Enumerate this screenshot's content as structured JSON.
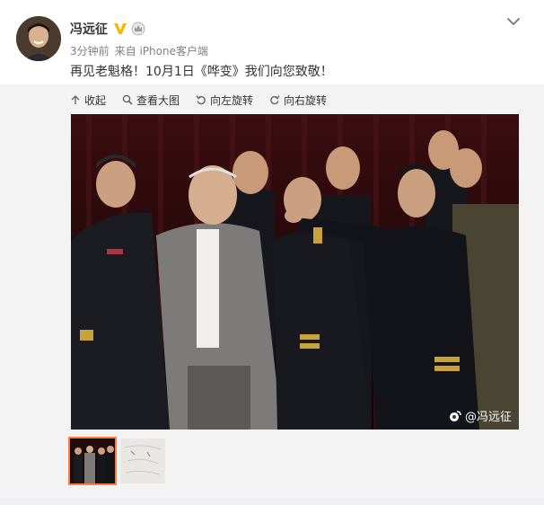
{
  "post": {
    "username": "冯远征",
    "time_ago": "3分钟前",
    "source": "来自 iPhone客户端",
    "text": "再见老魁格！10月1日《哗变》我们向您致敬！",
    "icons": {
      "verified": "verified-v-icon",
      "crown": "crown-badge-icon",
      "more": "chevron-down-icon"
    }
  },
  "toolbar": {
    "collapse": "收起",
    "view_large": "查看大图",
    "rotate_left": "向左旋转",
    "rotate_right": "向右旋转"
  },
  "image": {
    "watermark": "@冯远征",
    "subject": "stage photo of actors in naval uniforms and an older man in a grey suit"
  },
  "thumbnails": [
    {
      "active": true,
      "desc": "stage photo thumbnail"
    },
    {
      "active": false,
      "desc": "sketch/writing thumbnail"
    }
  ],
  "colors": {
    "accent": "#fa7d3c",
    "verified": "#f7b500",
    "text": "#333333",
    "meta": "#808080"
  }
}
